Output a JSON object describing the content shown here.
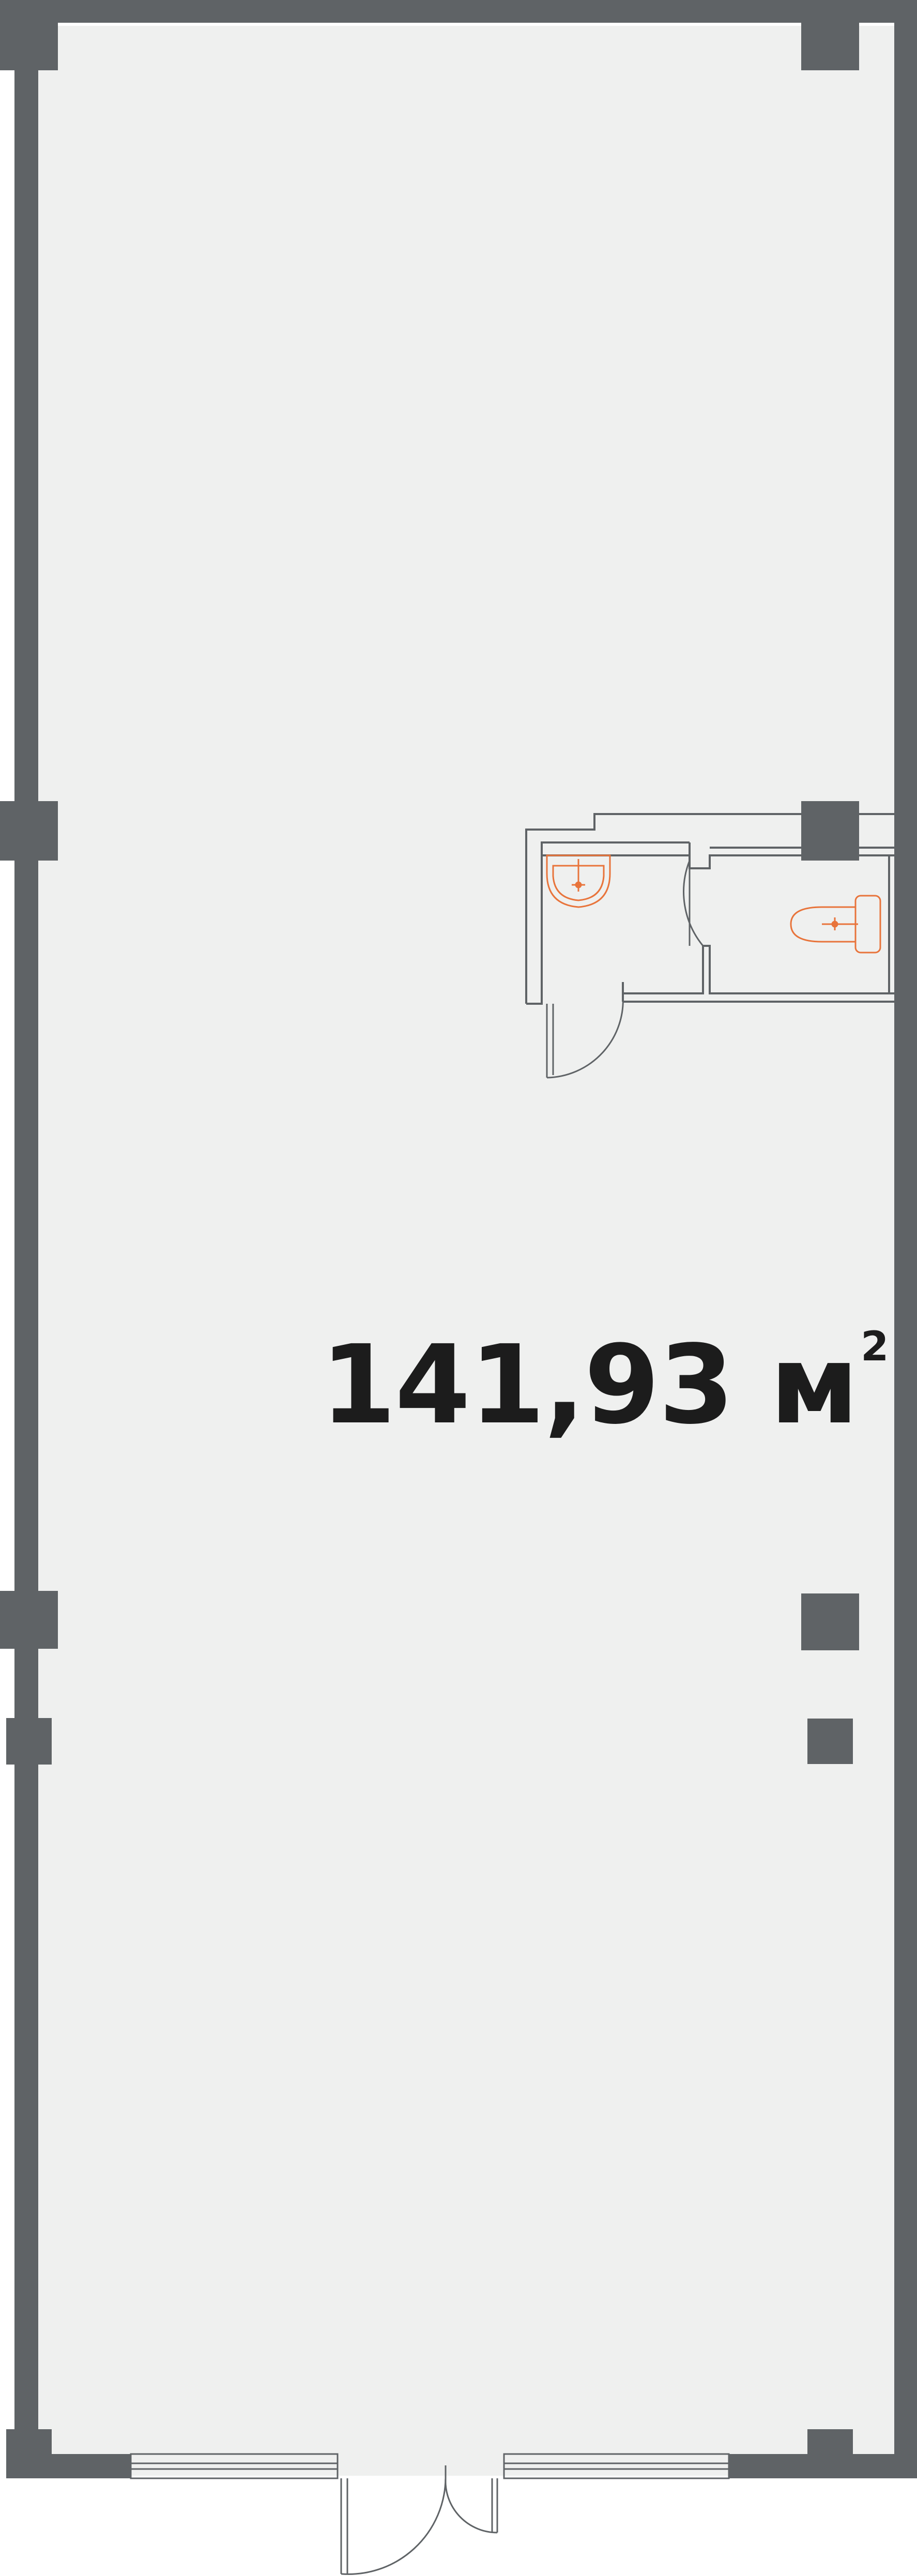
{
  "plan": {
    "area_value": "141,93",
    "area_unit": "м",
    "area_unit_exponent": "2"
  },
  "colors": {
    "wall": "#5f6366",
    "floor": "#eff0ef",
    "line": "#5f6366",
    "fixture": "#e8743b",
    "text": "#1c1c1c"
  },
  "icons": [
    "column-icon",
    "sink-icon",
    "toilet-icon",
    "door-swing-icon",
    "window-icon"
  ]
}
